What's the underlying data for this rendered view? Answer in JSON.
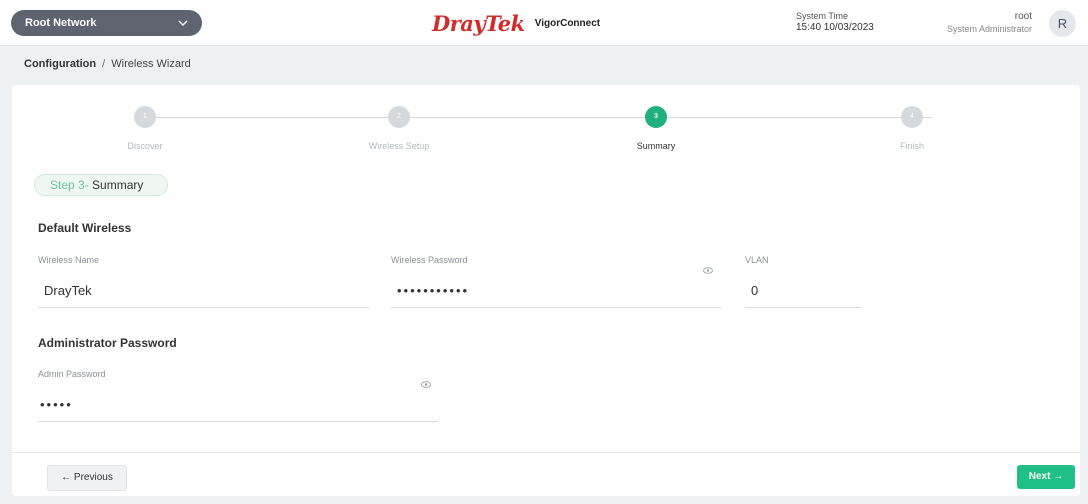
{
  "header": {
    "network_select": "Root Network",
    "brand_logo": "DrayTek",
    "brand_app": "VigorConnect",
    "system_time_label": "System Time",
    "system_time_value": "15:40 10/03/2023",
    "user_name": "root",
    "user_role": "System Administrator",
    "avatar_initial": "R"
  },
  "breadcrumb": {
    "root": "Configuration",
    "separator": "/",
    "current": "Wireless Wizard"
  },
  "stepper": {
    "steps": [
      {
        "number": "1",
        "label": "Discover",
        "active": false
      },
      {
        "number": "2",
        "label": "Wireless Setup",
        "active": false
      },
      {
        "number": "3",
        "label": "Summary",
        "active": true
      },
      {
        "number": "4",
        "label": "Finish",
        "active": false
      }
    ]
  },
  "step_pill": {
    "prefix": "Step 3-",
    "title": " Summary"
  },
  "default_wireless": {
    "title": "Default Wireless",
    "wireless_name_label": "Wireless Name",
    "wireless_name_value": "DrayTek",
    "wireless_password_label": "Wireless Password",
    "wireless_password_value": "•••••••••••",
    "vlan_label": "VLAN",
    "vlan_value": "0"
  },
  "admin": {
    "title": "Administrator Password",
    "admin_password_label": "Admin Password",
    "admin_password_value": "•••••"
  },
  "footer": {
    "previous_label": "← Previous",
    "next_label": "Next →"
  },
  "colors": {
    "accent": "#1fbf85",
    "brand_red": "#d12b2b",
    "header_select_bg": "#5d6470"
  }
}
